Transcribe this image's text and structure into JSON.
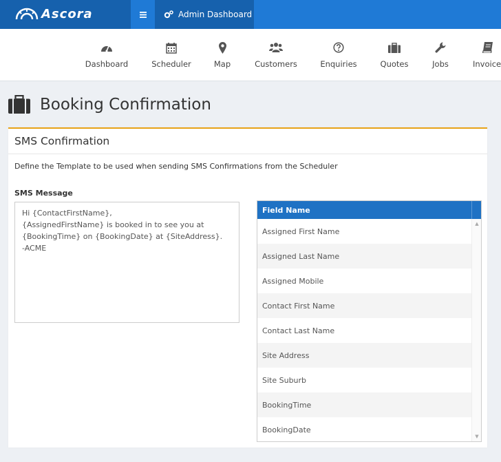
{
  "header": {
    "brand": "Ascora",
    "admin_tab": "Admin Dashboard"
  },
  "nav": {
    "items": [
      {
        "label": "Dashboard",
        "icon": "dashboard-icon"
      },
      {
        "label": "Scheduler",
        "icon": "calendar-icon"
      },
      {
        "label": "Map",
        "icon": "map-marker-icon"
      },
      {
        "label": "Customers",
        "icon": "users-icon"
      },
      {
        "label": "Enquiries",
        "icon": "question-circle-icon"
      },
      {
        "label": "Quotes",
        "icon": "briefcase-icon"
      },
      {
        "label": "Jobs",
        "icon": "wrench-icon"
      },
      {
        "label": "Invoices",
        "icon": "book-icon"
      }
    ]
  },
  "page": {
    "title": "Booking Confirmation"
  },
  "panel": {
    "heading": "SMS Confirmation",
    "description": "Define the Template to be used when sending SMS Confirmations from the Scheduler",
    "sms_label": "SMS Message",
    "sms_lines": [
      "Hi {ContactFirstName},",
      "{AssignedFirstName} is booked in to see you at",
      "{BookingTime} on {BookingDate} at {SiteAddress}.",
      "-ACME"
    ]
  },
  "grid": {
    "header": "Field Name",
    "rows": [
      "Assigned First Name",
      "Assigned Last Name",
      "Assigned Mobile",
      "Contact First Name",
      "Contact Last Name",
      "Site Address",
      "Site Suburb",
      "BookingTime",
      "BookingDate"
    ]
  },
  "colors": {
    "topbar": "#1f7ad6",
    "topbar_dark": "#1661ad",
    "accent": "#e8a317",
    "grid_header": "#1f72c4"
  }
}
